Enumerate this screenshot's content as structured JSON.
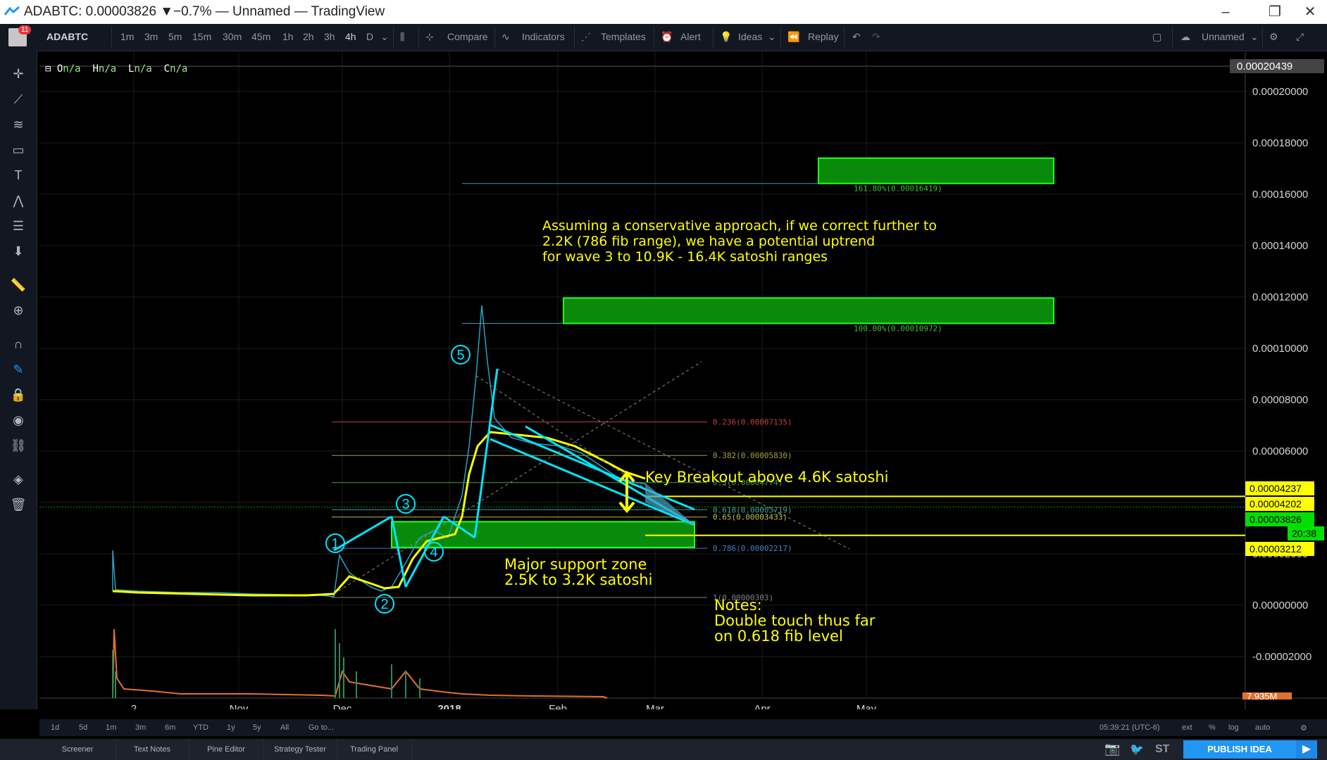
{
  "window": {
    "title": "ADABTC: 0.00003826 ▼−0.7% — Unnamed — TradingView"
  },
  "toolbar": {
    "avatar_badge": "11",
    "symbol": "ADABTC",
    "intervals": [
      "1m",
      "3m",
      "5m",
      "15m",
      "30m",
      "45m",
      "1h",
      "2h",
      "3h",
      "4h",
      "D"
    ],
    "selected_interval": "4h",
    "compare": "Compare",
    "indicators": "Indicators",
    "templates": "Templates",
    "alert": "Alert",
    "ideas": "Ideas",
    "replay": "Replay",
    "layout_name": "Unnamed"
  },
  "legend": {
    "o_label": "O",
    "o_val": "n/a",
    "h_label": "H",
    "h_val": "n/a",
    "l_label": "L",
    "l_val": "n/a",
    "c_label": "C",
    "c_val": "n/a"
  },
  "chart_data": {
    "type": "line",
    "symbol": "ADABTC",
    "interval": "4h",
    "y_axis_ticks": [
      "0.00020000",
      "0.00018000",
      "0.00016000",
      "0.00014000",
      "0.00012000",
      "0.00010000",
      "0.00008000",
      "0.00006000",
      "0.00004000",
      "0.00002000",
      "0.00000000",
      "-0.00002000"
    ],
    "y_top_label": "0.00020439",
    "x_axis_ticks": [
      "2",
      "Nov",
      "Dec",
      "2018",
      "Feb",
      "Mar",
      "Apr",
      "May"
    ],
    "price_labels": [
      {
        "text": "0.00004237",
        "color": "#ffff00"
      },
      {
        "text": "0.00004202",
        "color": "#ffff00"
      },
      {
        "text": "0.00003826",
        "color": "#00e000"
      },
      {
        "text": "20:38",
        "color": "#00e000"
      },
      {
        "text": "0.00003212",
        "color": "#ffff00"
      }
    ],
    "volume_label": "7.935M",
    "fib_levels": [
      {
        "label": "0.236(0.00007135)",
        "value": 7.135e-05,
        "color": "#c04040"
      },
      {
        "label": "0.382(0.00005830)",
        "value": 5.83e-05,
        "color": "#a0a040"
      },
      {
        "label": "0.5(0.00004774)",
        "value": 4.774e-05,
        "color": "#40a040"
      },
      {
        "label": "0.618(0.00003719)",
        "value": 3.719e-05,
        "color": "#40a0a0"
      },
      {
        "label": "0.65(0.00003433)",
        "value": 3.433e-05,
        "color": "#c0c040"
      },
      {
        "label": "0.786(0.00002217)",
        "value": 2.217e-05,
        "color": "#4080c0"
      },
      {
        "label": "1(0.00000303)",
        "value": 3.03e-06,
        "color": "#808080"
      }
    ],
    "extension_levels": [
      {
        "label": "161.80%(0.00016419)",
        "value": 0.00016419
      },
      {
        "label": "100.00%(0.00010972)",
        "value": 0.00010972
      }
    ],
    "wave_labels": [
      "1",
      "2",
      "3",
      "4",
      "5"
    ],
    "annotations": {
      "conservative": [
        "Assuming a conservative approach, if we correct further to",
        "2.2K (786 fib range), we have a potential uptrend",
        "for wave 3 to 10.9K - 16.4K satoshi ranges"
      ],
      "breakout": "Key Breakout above 4.6K satoshi",
      "support": [
        "Major support zone",
        "2.5K to 3.2K satoshi"
      ],
      "notes": [
        "Notes:",
        "Double touch thus far",
        "on 0.618 fib level"
      ]
    },
    "colors": {
      "price_line": "#ffff00",
      "trendline": "#00e5ff",
      "zone_fill": "#0a8a0a",
      "zone_border": "#22ff22",
      "annotation": "#ffff00"
    }
  },
  "bottom": {
    "ranges": [
      "1d",
      "5d",
      "1m",
      "3m",
      "6m",
      "YTD",
      "1y",
      "5y",
      "All"
    ],
    "goto": "Go to...",
    "clock": "05:39:21 (UTC-6)",
    "ext": "ext",
    "percent": "%",
    "log": "log",
    "auto": "auto"
  },
  "panels": {
    "tabs": [
      "Screener",
      "Text Notes",
      "Pine Editor",
      "Strategy Tester",
      "Trading Panel"
    ],
    "publish": "PUBLISH IDEA",
    "st": "ST"
  }
}
